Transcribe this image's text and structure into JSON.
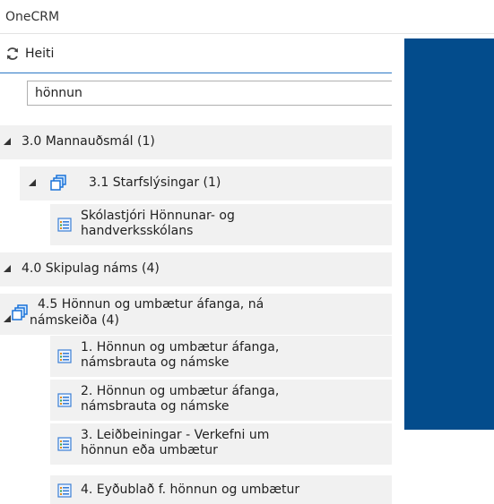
{
  "app": {
    "title": "OneCRM"
  },
  "panel": {
    "header_title": "Heiti",
    "search": {
      "value": "hönnun",
      "placeholder": ""
    }
  },
  "tree": {
    "n1": {
      "label": "3.0 Mannauðsmál (1)"
    },
    "n2": {
      "label": "3.1 Starfslýsingar (1)"
    },
    "n3": {
      "line1": "Skólastjóri Hönnunar- og",
      "line2": "handverksskólans"
    },
    "n4": {
      "label": "4.0 Skipulag náms (4)"
    },
    "n5": {
      "line1": "4.5 Hönnun og umbætur áfanga, ná",
      "line2": "námskeiða (4)"
    },
    "n6": {
      "line1": "1. Hönnun og umbætur áfanga,",
      "line2": "námsbrauta og námske"
    },
    "n7": {
      "line1": "2. Hönnun og umbætur áfanga,",
      "line2": "námsbrauta og námske"
    },
    "n8": {
      "line1": "3. Leiðbeiningar - Verkefni um",
      "line2": "hönnun eða umbætur"
    },
    "n9": {
      "label": "4. Eyðublað f. hönnun og umbætur"
    }
  },
  "colors": {
    "content_pane": "#034c8c",
    "accent_line": "#2b78c5",
    "row_bg": "#f1f1f1"
  },
  "icons": [
    "refresh-icon",
    "expand-arrow-icon",
    "folder-stack-icon",
    "document-list-icon"
  ]
}
